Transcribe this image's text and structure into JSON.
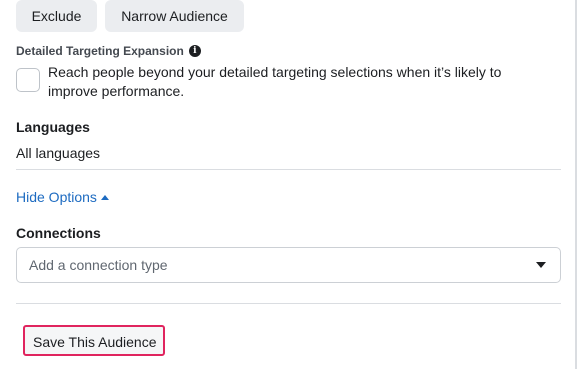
{
  "buttons": {
    "exclude_label": "Exclude",
    "narrow_label": "Narrow Audience"
  },
  "detailed_targeting_expansion": {
    "label": "Detailed Targeting Expansion",
    "info_glyph": "i",
    "description": "Reach people beyond your detailed targeting selections when it’s likely to improve performance.",
    "checked": false
  },
  "languages": {
    "label": "Languages",
    "value": "All languages"
  },
  "options_toggle": {
    "label": "Hide Options"
  },
  "connections": {
    "label": "Connections",
    "placeholder": "Add a connection type"
  },
  "save_audience": {
    "label": "Save This Audience"
  },
  "colors": {
    "link_blue": "#1d6bc1",
    "highlight_pink": "#e0245e",
    "button_gray": "#ebedf0"
  }
}
